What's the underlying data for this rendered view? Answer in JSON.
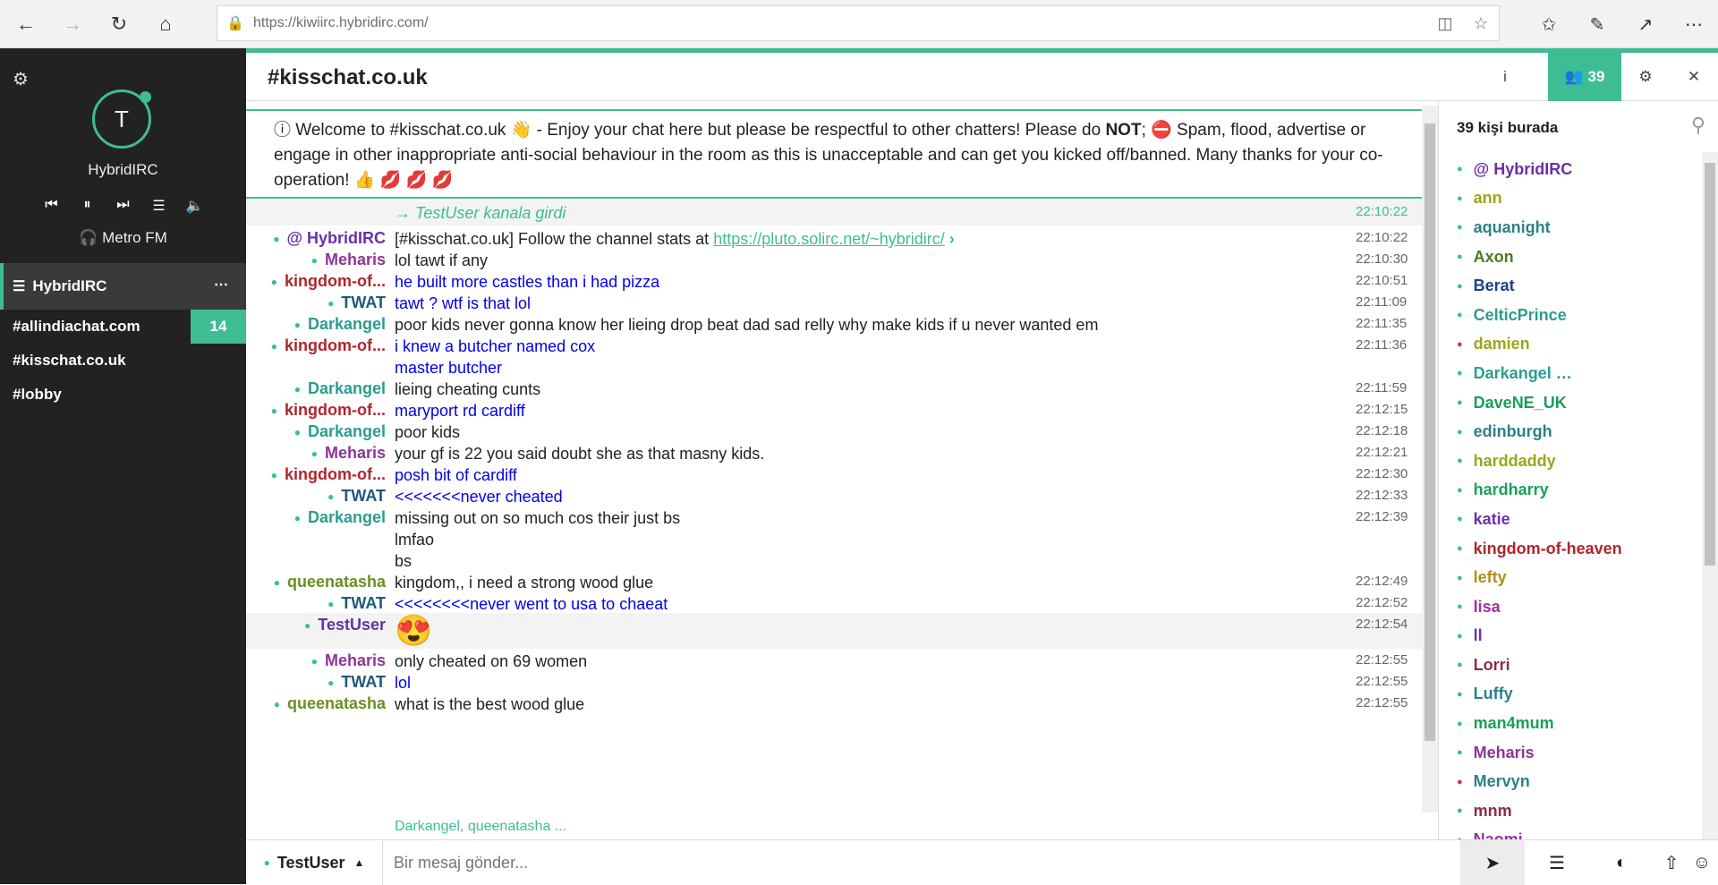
{
  "browser": {
    "url": "https://kiwiirc.hybridirc.com/"
  },
  "sidebar": {
    "avatar_letter": "T",
    "network_name": "HybridIRC",
    "radio_station": "Metro FM",
    "network_row_label": "HybridIRC",
    "channels": [
      {
        "name": "#allindiachat.com",
        "badge": "14"
      },
      {
        "name": "#kisschat.co.uk",
        "badge": ""
      },
      {
        "name": "#lobby",
        "badge": ""
      }
    ]
  },
  "header": {
    "channel_title": "#kisschat.co.uk",
    "info_label": "i",
    "user_count": "39"
  },
  "topic": {
    "part1": "ⓘ Welcome to #kisschat.co.uk 👋 - Enjoy your chat here but please be respectful to other chatters! Please do ",
    "bold": "NOT",
    "part2": "; ⛔ Spam, flood, advertise or engage in other inappropriate anti-social behaviour in the room as this is unacceptable and can get you kicked off/banned. Many thanks for your co-operation! 👍 💋 💋 💋"
  },
  "messages": [
    {
      "nick": "",
      "text": "→ TestUser kanala girdi",
      "time": "22:10:22",
      "kind": "join"
    },
    {
      "nick": "@ HybridIRC",
      "text": "[#kisschat.co.uk] Follow the channel stats at ",
      "link": "https://pluto.solirc.net/~hybridirc/",
      "time": "22:10:22",
      "color": "#6b2fa8"
    },
    {
      "nick": "Meharis",
      "text": "lol tawt if any",
      "time": "22:10:30",
      "color": "#8e3596"
    },
    {
      "nick": "kingdom-of...",
      "text": "he built  more  castles  than i had  pizza",
      "time": "22:10:51",
      "color": "#b0262c",
      "blue": true
    },
    {
      "nick": "TWAT",
      "text": "tawt ? wtf is that lol",
      "time": "22:11:09",
      "color": "#1f5a7a",
      "blue": true
    },
    {
      "nick": "Darkangel",
      "text": "poor kids never gonna know her lieing drop beat dad sad relly why make kids if u never wanted em",
      "time": "22:11:35",
      "color": "#2a9d8f"
    },
    {
      "nick": "kingdom-of...",
      "text": "i knew  a butcher  named  cox",
      "time": "22:11:36",
      "color": "#b0262c",
      "blue": true
    },
    {
      "nick": "",
      "text": "master  butcher",
      "time": "",
      "blue": true
    },
    {
      "nick": "Darkangel",
      "text": "lieing cheating cunts",
      "time": "22:11:59",
      "color": "#2a9d8f"
    },
    {
      "nick": "kingdom-of...",
      "text": "maryport  rd  cardiff",
      "time": "22:12:15",
      "color": "#b0262c",
      "blue": true
    },
    {
      "nick": "Darkangel",
      "text": "poor kids",
      "time": "22:12:18",
      "color": "#2a9d8f"
    },
    {
      "nick": "Meharis",
      "text": "your gf is 22 you said doubt she as that masny kids.",
      "time": "22:12:21",
      "color": "#8e3596"
    },
    {
      "nick": "kingdom-of...",
      "text": "posh  bit  of cardiff",
      "time": "22:12:30",
      "color": "#b0262c",
      "blue": true
    },
    {
      "nick": "TWAT",
      "text": "<<<<<<<never cheated",
      "time": "22:12:33",
      "color": "#1f5a7a",
      "blue": true
    },
    {
      "nick": "Darkangel",
      "text": "missing out on so much cos their just bs",
      "time": "22:12:39",
      "color": "#2a9d8f"
    },
    {
      "nick": "",
      "text": "lmfao",
      "time": ""
    },
    {
      "nick": "",
      "text": "bs",
      "time": ""
    },
    {
      "nick": "queenatasha",
      "text": "kingdom,, i  need a strong wood glue",
      "time": "22:12:49",
      "color": "#6b8e23"
    },
    {
      "nick": "TWAT",
      "text": "<<<<<<<<never went to usa to chaeat",
      "time": "22:12:52",
      "color": "#1f5a7a",
      "blue": true
    },
    {
      "nick": "TestUser",
      "text": "😍",
      "time": "22:12:54",
      "color": "#6b2fa8",
      "highlight": true
    },
    {
      "nick": "Meharis",
      "text": "only cheated on 69 women",
      "time": "22:12:55",
      "color": "#8e3596"
    },
    {
      "nick": "TWAT",
      "text": "lol",
      "time": "22:12:55",
      "color": "#1f5a7a",
      "blue": true
    },
    {
      "nick": "queenatasha",
      "text": "what is the best wood glue",
      "time": "22:12:55",
      "color": "#6b8e23"
    }
  ],
  "typing_indicator": "Darkangel, queenatasha ...",
  "input": {
    "nick": "TestUser",
    "placeholder": "Bir mesaj gönder..."
  },
  "userpanel": {
    "heading": "39 kişi burada",
    "users": [
      {
        "name": "@ HybridIRC",
        "color": "#6b2fa8",
        "away": false
      },
      {
        "name": "ann",
        "color": "#9aa61a",
        "away": false
      },
      {
        "name": "aquanight",
        "color": "#2d7f8c",
        "away": false
      },
      {
        "name": "Axon",
        "color": "#4a7c1f",
        "away": false
      },
      {
        "name": "Berat",
        "color": "#1f3f8c",
        "away": false
      },
      {
        "name": "CelticPrince",
        "color": "#2a9d8f",
        "away": false
      },
      {
        "name": "damien",
        "color": "#9aa61a",
        "away": true
      },
      {
        "name": "Darkangel …",
        "color": "#2a9d8f",
        "away": false
      },
      {
        "name": "DaveNE_UK",
        "color": "#1a9e5b",
        "away": false
      },
      {
        "name": "edinburgh",
        "color": "#2d7f8c",
        "away": false
      },
      {
        "name": "harddaddy",
        "color": "#9aa61a",
        "away": false
      },
      {
        "name": "hardharry",
        "color": "#1a9e5b",
        "away": false
      },
      {
        "name": "katie",
        "color": "#6b2fa8",
        "away": false
      },
      {
        "name": "kingdom-of-heaven",
        "color": "#b0262c",
        "away": false
      },
      {
        "name": "lefty",
        "color": "#b08f1a",
        "away": false
      },
      {
        "name": "lisa",
        "color": "#a02fa8",
        "away": false
      },
      {
        "name": "ll",
        "color": "#6b2fa8",
        "away": false
      },
      {
        "name": "Lorri",
        "color": "#8e2c44",
        "away": false
      },
      {
        "name": "Luffy",
        "color": "#2d7f8c",
        "away": false
      },
      {
        "name": "man4mum",
        "color": "#1a9e5b",
        "away": false
      },
      {
        "name": "Meharis",
        "color": "#8e3596",
        "away": false
      },
      {
        "name": "Mervyn",
        "color": "#2d7f8c",
        "away": true
      },
      {
        "name": "mnm",
        "color": "#8e2c44",
        "away": false
      },
      {
        "name": "Naomi",
        "color": "#8e3596",
        "away": false
      }
    ]
  }
}
